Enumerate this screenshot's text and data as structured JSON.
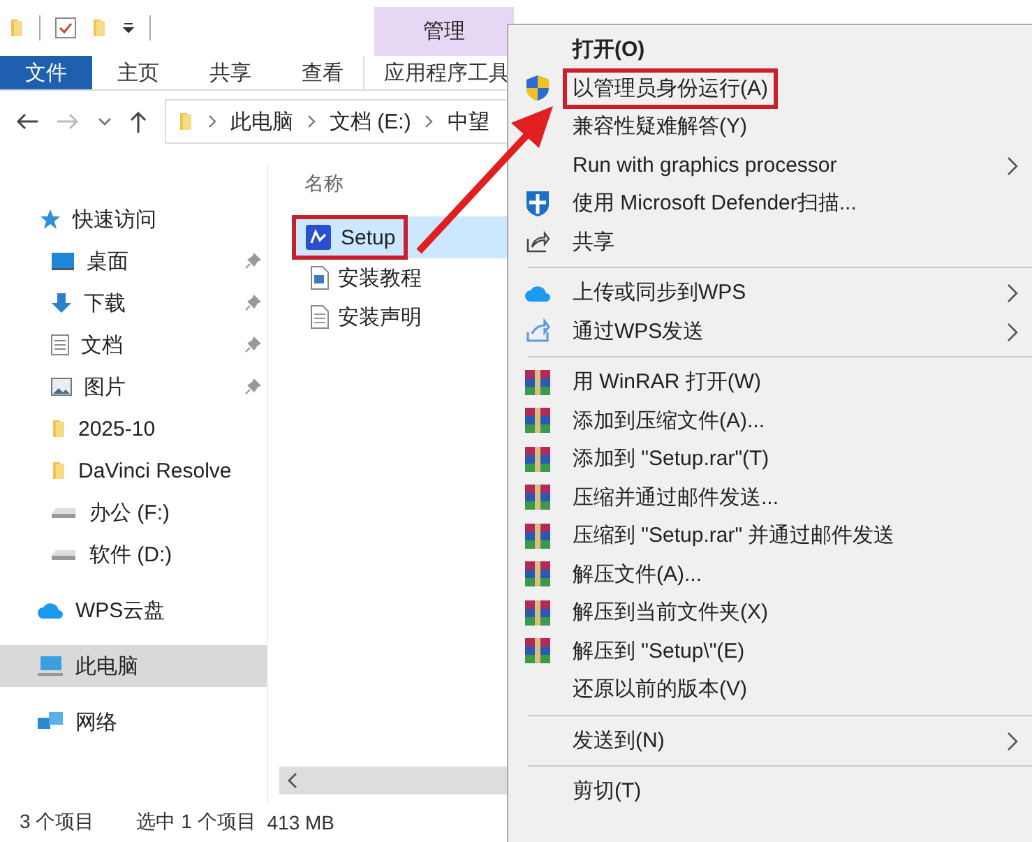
{
  "ribbon": {
    "context_tab": "管理",
    "tabs": [
      {
        "label": "文件",
        "selected": true
      },
      {
        "label": "主页",
        "selected": false
      },
      {
        "label": "共享",
        "selected": false
      },
      {
        "label": "查看",
        "selected": false
      },
      {
        "label": "应用程序工具",
        "selected": false
      }
    ]
  },
  "address_bar": {
    "crumbs": [
      "此电脑",
      "文档 (E:)",
      "中望"
    ]
  },
  "sidebar": {
    "items": [
      {
        "label": "快速访问",
        "pinned": false,
        "selected": false
      },
      {
        "label": "桌面",
        "pinned": true,
        "selected": false
      },
      {
        "label": "下载",
        "pinned": true,
        "selected": false
      },
      {
        "label": "文档",
        "pinned": true,
        "selected": false
      },
      {
        "label": "图片",
        "pinned": true,
        "selected": false
      },
      {
        "label": "2025-10",
        "pinned": false,
        "selected": false
      },
      {
        "label": "DaVinci Resolve",
        "pinned": false,
        "selected": false
      },
      {
        "label": "办公 (F:)",
        "pinned": false,
        "selected": false
      },
      {
        "label": "软件 (D:)",
        "pinned": false,
        "selected": false
      },
      {
        "label": "WPS云盘",
        "pinned": false,
        "selected": false
      },
      {
        "label": "此电脑",
        "pinned": false,
        "selected": true
      },
      {
        "label": "网络",
        "pinned": false,
        "selected": false
      }
    ]
  },
  "files": {
    "column": "名称",
    "rows": [
      {
        "name": "Setup",
        "selected": true,
        "annotated": true
      },
      {
        "name": "安装教程",
        "selected": false,
        "annotated": false
      },
      {
        "name": "安装声明",
        "selected": false,
        "annotated": false
      }
    ]
  },
  "status_bar": [
    "3 个项目",
    "选中 1 个项目",
    "413 MB"
  ],
  "context_menu": {
    "items": [
      {
        "kind": "plain",
        "label": "打开(O)",
        "bold": true,
        "submenu": false,
        "annotated": false
      },
      {
        "kind": "admin",
        "label": "以管理员身份运行(A)",
        "bold": false,
        "submenu": false,
        "annotated": true
      },
      {
        "kind": "plain",
        "label": "兼容性疑难解答(Y)",
        "bold": false,
        "submenu": false,
        "annotated": false
      },
      {
        "kind": "plain",
        "label": "Run with graphics processor",
        "bold": false,
        "submenu": true,
        "annotated": false
      },
      {
        "kind": "defender",
        "label": "使用 Microsoft Defender扫描...",
        "bold": false,
        "submenu": false,
        "annotated": false
      },
      {
        "kind": "share",
        "label": "共享",
        "bold": false,
        "submenu": false,
        "annotated": false
      },
      {
        "kind": "separator"
      },
      {
        "kind": "cloud",
        "label": "上传或同步到WPS",
        "bold": false,
        "submenu": true,
        "annotated": false
      },
      {
        "kind": "send",
        "label": "通过WPS发送",
        "bold": false,
        "submenu": true,
        "annotated": false
      },
      {
        "kind": "separator"
      },
      {
        "kind": "archive",
        "label": "用 WinRAR 打开(W)",
        "bold": false,
        "submenu": false,
        "annotated": false
      },
      {
        "kind": "archive",
        "label": "添加到压缩文件(A)...",
        "bold": false,
        "submenu": false,
        "annotated": false
      },
      {
        "kind": "archive",
        "label": "添加到 \"Setup.rar\"(T)",
        "bold": false,
        "submenu": false,
        "annotated": false
      },
      {
        "kind": "archive",
        "label": "压缩并通过邮件发送...",
        "bold": false,
        "submenu": false,
        "annotated": false
      },
      {
        "kind": "archive",
        "label": "压缩到 \"Setup.rar\" 并通过邮件发送",
        "bold": false,
        "submenu": false,
        "annotated": false
      },
      {
        "kind": "archive",
        "label": "解压文件(A)...",
        "bold": false,
        "submenu": false,
        "annotated": false
      },
      {
        "kind": "archive",
        "label": "解压到当前文件夹(X)",
        "bold": false,
        "submenu": false,
        "annotated": false
      },
      {
        "kind": "archive",
        "label": "解压到 \"Setup\\\"(E)",
        "bold": false,
        "submenu": false,
        "annotated": false
      },
      {
        "kind": "plain",
        "label": "还原以前的版本(V)",
        "bold": false,
        "submenu": false,
        "annotated": false
      },
      {
        "kind": "separator"
      },
      {
        "kind": "plain",
        "label": "发送到(N)",
        "bold": false,
        "submenu": true,
        "annotated": false
      },
      {
        "kind": "separator"
      },
      {
        "kind": "plain",
        "label": "剪切(T)",
        "bold": false,
        "submenu": false,
        "annotated": false
      }
    ]
  }
}
